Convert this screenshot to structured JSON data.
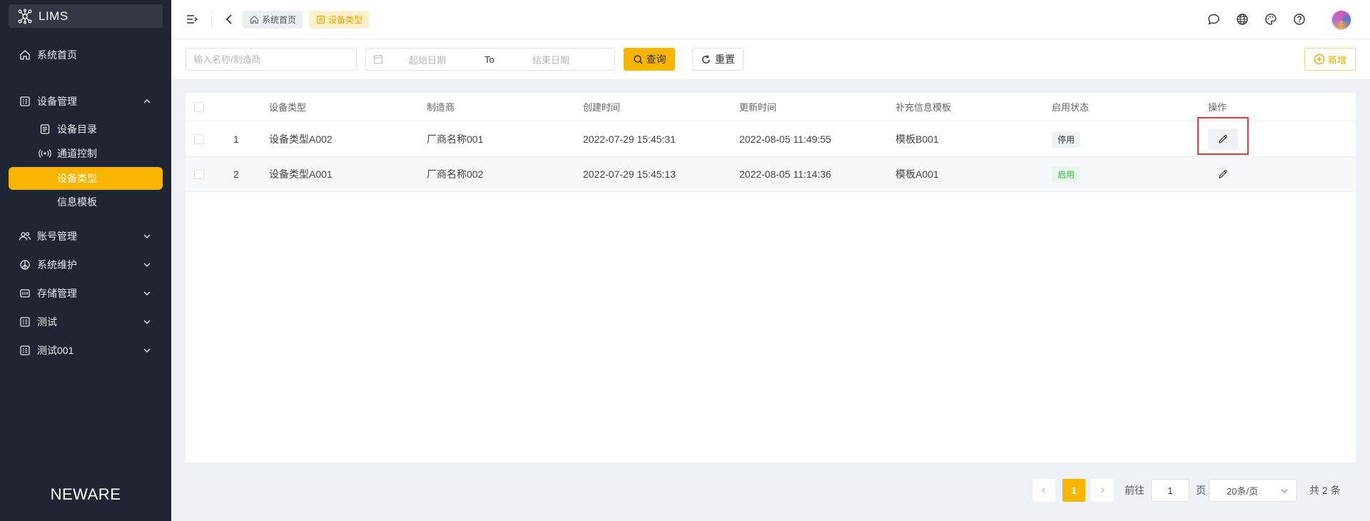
{
  "app": {
    "name": "LIMS",
    "brand": "NEWARE"
  },
  "sidebar": {
    "items": [
      {
        "label": "系统首页",
        "icon": "home-icon"
      },
      {
        "label": "设备管理",
        "icon": "grid-list-icon",
        "expanded": true,
        "children": [
          {
            "label": "设备目录",
            "icon": "list-icon"
          },
          {
            "label": "通道控制",
            "icon": "broadcast-icon"
          },
          {
            "label": "设备类型",
            "icon": "",
            "active": true
          },
          {
            "label": "信息模板",
            "icon": ""
          }
        ]
      },
      {
        "label": "账号管理",
        "icon": "users-icon"
      },
      {
        "label": "系统维护",
        "icon": "peace-icon"
      },
      {
        "label": "存储管理",
        "icon": "storage-icon"
      },
      {
        "label": "测试",
        "icon": "grid-list-icon"
      },
      {
        "label": "测试001",
        "icon": "grid-list-icon"
      }
    ]
  },
  "topbar": {
    "breadcrumbs": [
      {
        "label": "系统首页",
        "icon": "home-icon"
      },
      {
        "label": "设备类型",
        "icon": "grid-icon",
        "current": true
      }
    ],
    "icons": [
      "chat-icon",
      "globe-icon",
      "palette-icon",
      "help-icon"
    ]
  },
  "filter": {
    "name_placeholder": "输入名称/制造商",
    "start_placeholder": "起始日期",
    "to": "To",
    "end_placeholder": "结束日期",
    "query_label": "查询",
    "reset_label": "重置",
    "add_label": "新增"
  },
  "table": {
    "headers": [
      "设备类型",
      "制造商",
      "创建时间",
      "更新时间",
      "补充信息模板",
      "启用状态",
      "操作"
    ],
    "rows": [
      {
        "index": "1",
        "type": "设备类型A002",
        "maker": "厂商名称001",
        "created": "2022-07-29 15:45:31",
        "updated": "2022-08-05 11:49:55",
        "template": "模板B001",
        "status": "停用",
        "status_color": "#333333"
      },
      {
        "index": "2",
        "type": "设备类型A001",
        "maker": "厂商名称002",
        "created": "2022-07-29 15:45:13",
        "updated": "2022-08-05 11:14:36",
        "template": "模板A001",
        "status": "启用",
        "status_color": "#3bb346"
      }
    ]
  },
  "pagination": {
    "current": "1",
    "goto_label": "前往",
    "goto_value": "1",
    "page_unit": "页",
    "page_size": "20条/页",
    "total": "共 2 条"
  },
  "colors": {
    "accent": "#f7b500",
    "sidebar_bg": "#1f2532",
    "highlight": "#e53935"
  }
}
